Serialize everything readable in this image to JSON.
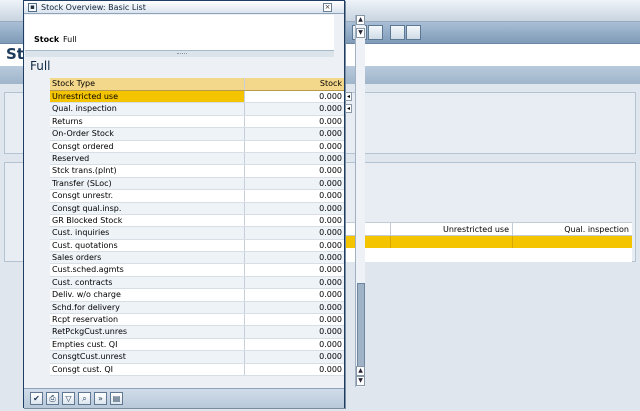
{
  "dialog": {
    "title": "Stock Overview: Basic List",
    "header_label": "Stock",
    "header_value": "Full",
    "list_title": "Full",
    "columns": [
      "Stock Type",
      "Stock"
    ],
    "rows": [
      {
        "type": "Unrestricted use",
        "stock": "0.000"
      },
      {
        "type": "Qual. inspection",
        "stock": "0.000"
      },
      {
        "type": "Returns",
        "stock": "0.000"
      },
      {
        "type": "On-Order Stock",
        "stock": "0.000"
      },
      {
        "type": "Consgt ordered",
        "stock": "0.000"
      },
      {
        "type": "Reserved",
        "stock": "0.000"
      },
      {
        "type": "Stck trans.(plnt)",
        "stock": "0.000"
      },
      {
        "type": "Transfer (SLoc)",
        "stock": "0.000"
      },
      {
        "type": "Consgt unrestr.",
        "stock": "0.000"
      },
      {
        "type": "Consgt qual.insp.",
        "stock": "0.000"
      },
      {
        "type": "GR Blocked Stock",
        "stock": "0.000"
      },
      {
        "type": "Cust. inquiries",
        "stock": "0.000"
      },
      {
        "type": "Cust. quotations",
        "stock": "0.000"
      },
      {
        "type": "Sales orders",
        "stock": "0.000"
      },
      {
        "type": "Cust.sched.agmts",
        "stock": "0.000"
      },
      {
        "type": "Cust. contracts",
        "stock": "0.000"
      },
      {
        "type": "Deliv. w/o charge",
        "stock": "0.000"
      },
      {
        "type": "Schd.for delivery",
        "stock": "0.000"
      },
      {
        "type": "Rcpt reservation",
        "stock": "0.000"
      },
      {
        "type": "RetPckgCust.unres",
        "stock": "0.000"
      },
      {
        "type": "Empties cust. QI",
        "stock": "0.000"
      },
      {
        "type": "ConsgtCust.unrest",
        "stock": "0.000"
      },
      {
        "type": "Consgt cust. QI",
        "stock": "0.000"
      }
    ],
    "footer_buttons": [
      "check-icon",
      "print-icon",
      "filter-icon",
      "find-icon",
      "find-next-icon",
      "details-icon"
    ]
  },
  "background": {
    "heading_fragment": "St",
    "grid_headers": [
      "Unrestricted use",
      "Qual. inspection"
    ]
  },
  "colors": {
    "selection": "#f5c400",
    "header_bar": "#f3d78a",
    "dialog_border": "#1d3d62"
  }
}
